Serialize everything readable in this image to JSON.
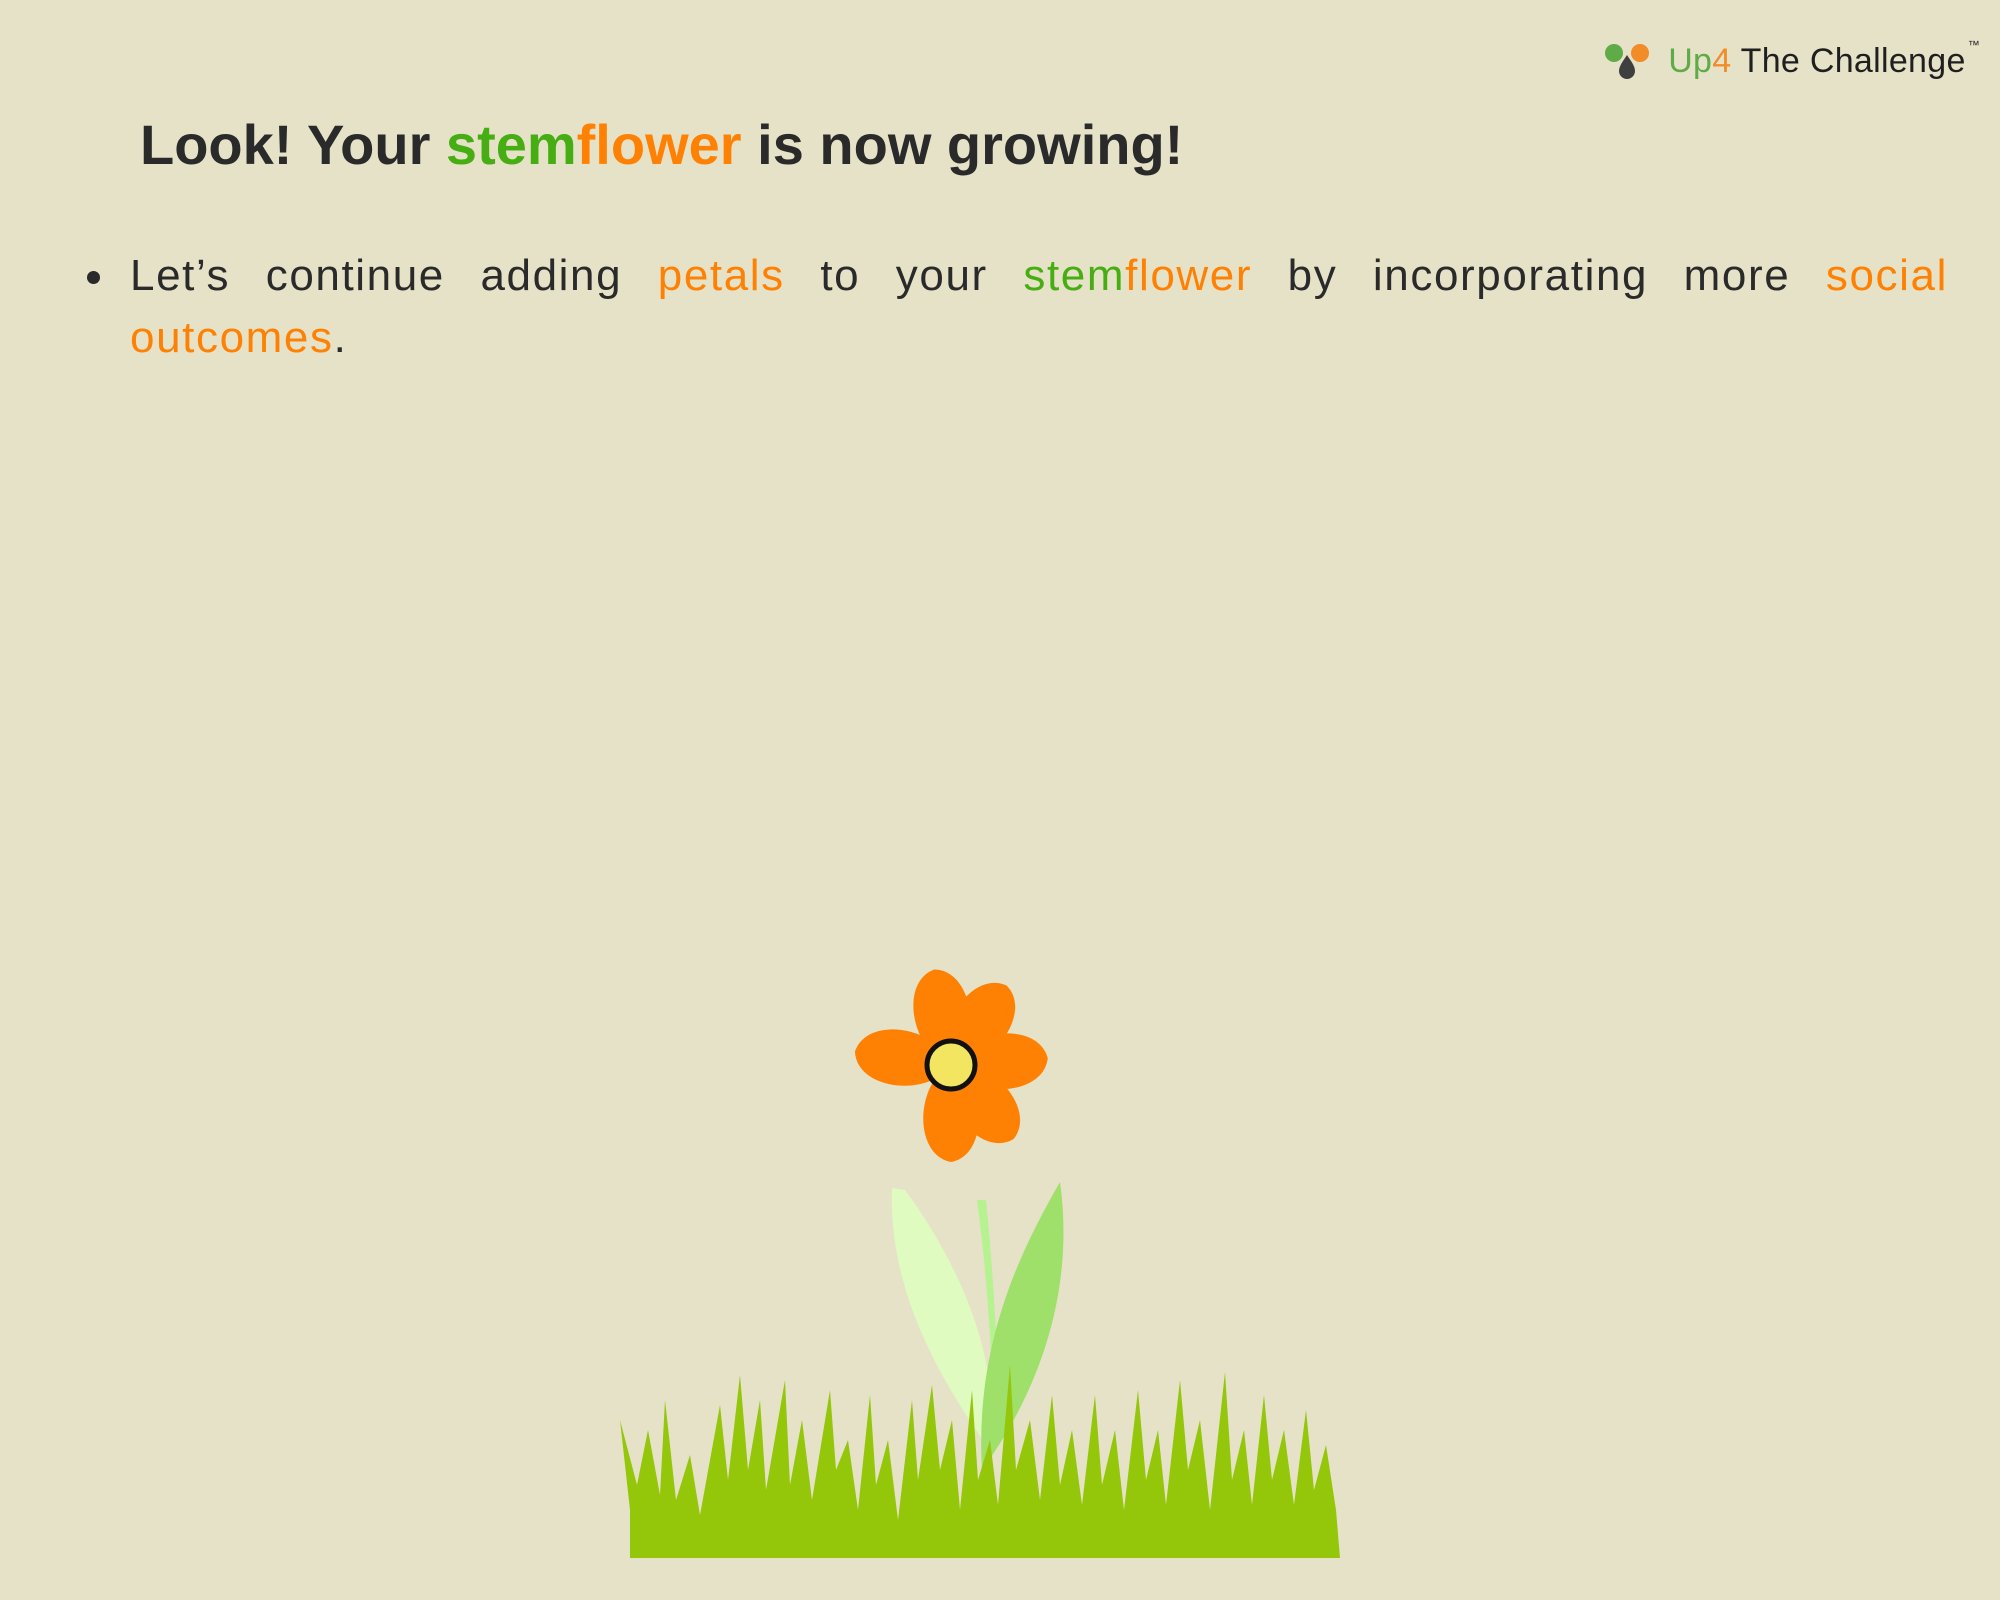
{
  "brand": {
    "name_up": "Up",
    "name_four": "4",
    "name_rest": " The Challenge",
    "trademark": "™",
    "logo_icon": "three-drops-logo-icon"
  },
  "headline": {
    "prefix": "Look! Your ",
    "stem": "stem",
    "flower": "flower",
    "suffix": " is now growing!"
  },
  "bullets": [
    {
      "t1": "Let’s continue adding ",
      "petals": "petals",
      "t2": " to your ",
      "stem": "stem",
      "flower": "flower",
      "t3": " by incorporating more ",
      "social_outcomes": "social outcomes",
      "t4": "."
    }
  ],
  "illustration": {
    "icon": "flower-in-grass-illustration",
    "petal_count": 6
  },
  "colors": {
    "background": "#e6e2c8",
    "text": "#2a2a2a",
    "green_accent": "#46ad12",
    "orange_accent": "#ff8103",
    "petal": "#ff8103",
    "flower_center": "#f3e55f",
    "grass": "#94c60a",
    "leaf_light": "#dffbc0",
    "leaf_mid": "#9ee06a",
    "stem": "#b6f290"
  }
}
